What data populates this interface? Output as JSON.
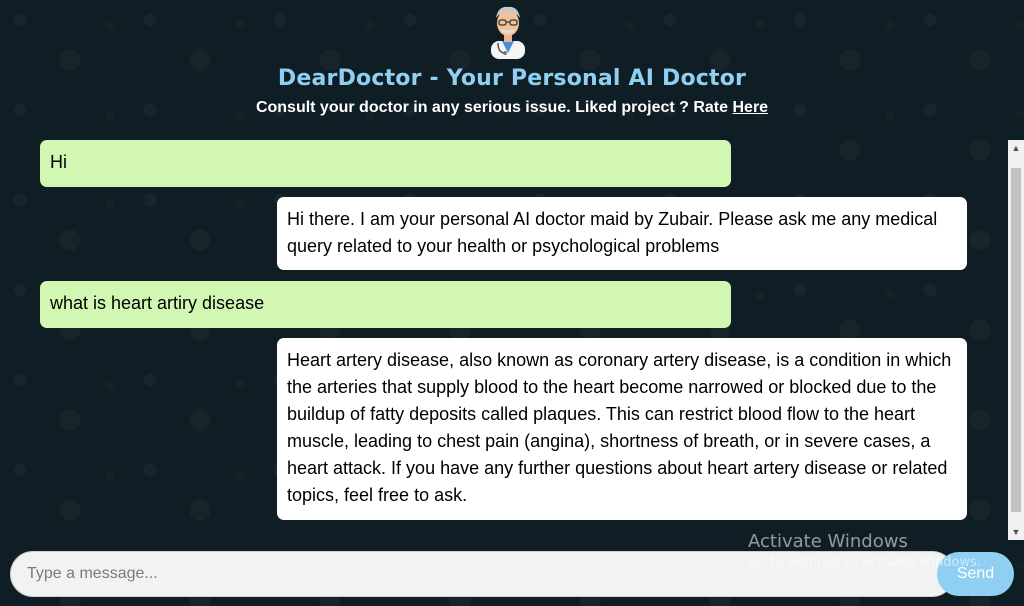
{
  "header": {
    "title": "DearDoctor - Your Personal AI Doctor",
    "subtitle_text": "Consult your doctor in any serious issue. Liked project ? Rate ",
    "rate_link": "Here",
    "avatar_icon": "doctor-avatar-icon"
  },
  "messages": [
    {
      "role": "user",
      "text": "Hi"
    },
    {
      "role": "bot",
      "text": "Hi there. I am your personal AI doctor maid by Zubair. Please ask me any medical query related to your health or psychological problems"
    },
    {
      "role": "user",
      "text": "what is heart artiry disease"
    },
    {
      "role": "bot",
      "text": "Heart artery disease, also known as coronary artery disease, is a condition in which the arteries that supply blood to the heart become narrowed or blocked due to the buildup of fatty deposits called plaques. This can restrict blood flow to the heart muscle, leading to chest pain (angina), shortness of breath, or in severe cases, a heart attack. If you have any further questions about heart artery disease or related topics, feel free to ask."
    }
  ],
  "input": {
    "placeholder": "Type a message..."
  },
  "send_label": "Send",
  "watermark": {
    "title": "Activate Windows",
    "subtitle": "Go to Settings to activate Windows."
  },
  "colors": {
    "background": "#0f1e24",
    "accent": "#8fd0f2",
    "user_bubble": "#d2f7b3",
    "bot_bubble": "#ffffff"
  }
}
